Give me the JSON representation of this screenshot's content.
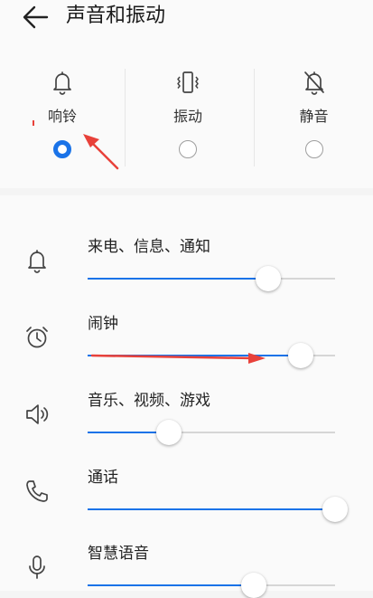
{
  "header": {
    "title": "声音和振动",
    "back_icon": "back-arrow-icon"
  },
  "modes": [
    {
      "label": "响铃",
      "icon": "bell-icon",
      "selected": true
    },
    {
      "label": "振动",
      "icon": "vibrate-icon",
      "selected": false
    },
    {
      "label": "静音",
      "icon": "bell-off-icon",
      "selected": false
    }
  ],
  "volumes": [
    {
      "label": "来电、信息、通知",
      "icon": "bell-icon",
      "level": 0.73
    },
    {
      "label": "闹钟",
      "icon": "alarm-clock-icon",
      "level": 0.86
    },
    {
      "label": "音乐、视频、游戏",
      "icon": "speaker-icon",
      "level": 0.33
    },
    {
      "label": "通话",
      "icon": "phone-icon",
      "level": 1.0
    },
    {
      "label": "智慧语音",
      "icon": "microphone-icon",
      "level": 0.67
    }
  ],
  "colors": {
    "accent": "#1a73e8",
    "track": "#d6d6d6",
    "annotation": "#e8413a"
  }
}
